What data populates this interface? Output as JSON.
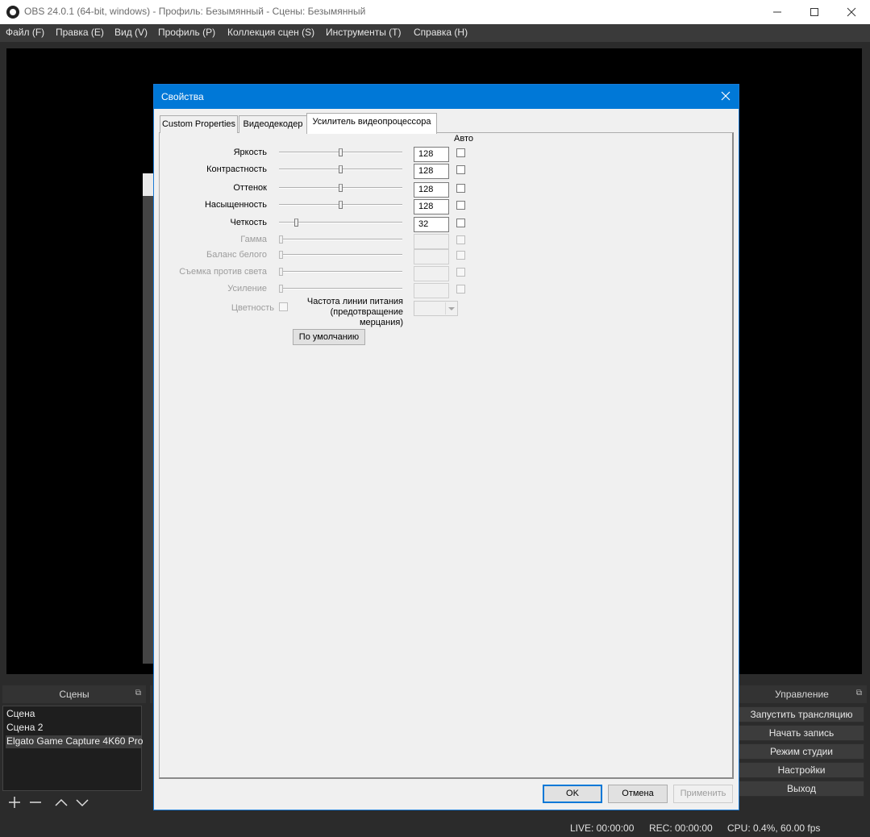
{
  "window": {
    "title": "OBS 24.0.1 (64-bit, windows) - Профиль: Безымянный - Сцены: Безымянный"
  },
  "menu": [
    "Файл (F)",
    "Правка (E)",
    "Вид (V)",
    "Профиль (P)",
    "Коллекция сцен (S)",
    "Инструменты (T)",
    "Справка (H)"
  ],
  "docks": {
    "scenes": {
      "title": "Сцены",
      "items": [
        "Сцена",
        "Сцена 2",
        "Elgato Game Capture 4K60 Pro"
      ],
      "selected_index": 2
    },
    "controls": {
      "title": "Управление",
      "buttons": [
        "Запустить трансляцию",
        "Начать запись",
        "Режим студии",
        "Настройки",
        "Выход"
      ]
    }
  },
  "status": {
    "live": "LIVE: 00:00:00",
    "rec": "REC: 00:00:00",
    "cpu": "CPU: 0.4%, 60.00 fps"
  },
  "dialog": {
    "title": "Свойства",
    "tabs": [
      "Custom Properties",
      "Видеодекодер",
      "Усилитель видеопроцессора"
    ],
    "active_tab": 2,
    "auto_header": "Авто",
    "properties": [
      {
        "label": "Яркость",
        "value": "128",
        "level": 0.5,
        "enabled": true,
        "auto_checked": false
      },
      {
        "label": "Контрастность",
        "value": "128",
        "level": 0.5,
        "enabled": true,
        "auto_checked": false
      },
      {
        "label": "Оттенок",
        "value": "128",
        "level": 0.5,
        "enabled": true,
        "auto_checked": false
      },
      {
        "label": "Насыщенность",
        "value": "128",
        "level": 0.5,
        "enabled": true,
        "auto_checked": false
      },
      {
        "label": "Четкость",
        "value": "32",
        "level": 0.13,
        "enabled": true,
        "auto_checked": false
      },
      {
        "label": "Гамма",
        "value": "",
        "level": 0,
        "enabled": false,
        "auto_checked": false
      },
      {
        "label": "Баланс белого",
        "value": "",
        "level": 0,
        "enabled": false,
        "auto_checked": false
      },
      {
        "label": "Съемка против света",
        "value": "",
        "level": 0,
        "enabled": false,
        "auto_checked": false
      },
      {
        "label": "Усиление",
        "value": "",
        "level": 0,
        "enabled": false,
        "auto_checked": false
      }
    ],
    "color_label": "Цветность",
    "powerline": {
      "line1": "Частота линии питания",
      "line2": "(предотвращение",
      "line3": "мерцания)"
    },
    "default_button": "По умолчанию",
    "ok": "OK",
    "cancel": "Отмена",
    "apply": "Применить"
  }
}
